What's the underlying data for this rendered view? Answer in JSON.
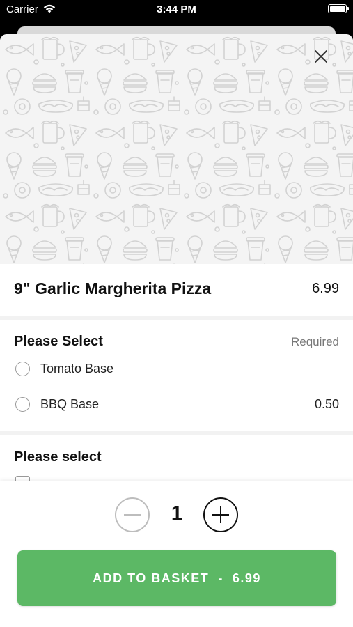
{
  "status_bar": {
    "carrier": "Carrier",
    "time": "3:44 PM"
  },
  "item": {
    "name": "9\" Garlic Margherita Pizza",
    "price": "6.99"
  },
  "option_group_1": {
    "header": "Please Select",
    "required_label": "Required",
    "options": [
      {
        "label": "Tomato Base",
        "extra": ""
      },
      {
        "label": "BBQ Base",
        "extra": "0.50"
      }
    ]
  },
  "option_group_2": {
    "header": "Please select"
  },
  "quantity": {
    "value": "1"
  },
  "add_button": {
    "label": "ADD TO BASKET",
    "separator": "-",
    "price": "6.99"
  },
  "colors": {
    "accent": "#5cb865",
    "pattern_line": "#d6d6d6"
  },
  "icons": {
    "close": "close-icon",
    "minus": "minus-icon",
    "plus": "plus-icon",
    "wifi": "wifi-icon",
    "battery": "battery-icon"
  }
}
